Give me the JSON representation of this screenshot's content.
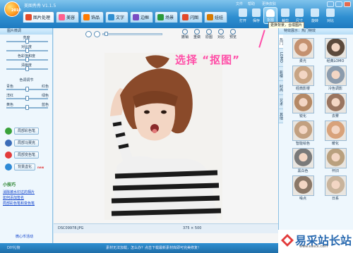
{
  "app": {
    "title": "美图秀秀 V1.1.5",
    "logo": "2010"
  },
  "tabs": [
    {
      "label": "图片处理",
      "color": "#e34a2a",
      "active": true
    },
    {
      "label": "美容",
      "color": "#ff5e8e"
    },
    {
      "label": "饰品",
      "color": "#ff7a00"
    },
    {
      "label": "文字",
      "color": "#2f8fd1"
    },
    {
      "label": "边框",
      "color": "#7a4bc2"
    },
    {
      "label": "场景",
      "color": "#2a9a3a"
    },
    {
      "label": "闪图",
      "color": "#e34a2a"
    },
    {
      "label": "娃娃",
      "color": "#d67a00"
    }
  ],
  "toolbar": [
    {
      "label": "打开",
      "icon": "folder-icon"
    },
    {
      "label": "保存",
      "icon": "save-icon"
    },
    {
      "label": "抠图",
      "icon": "cutout-icon"
    },
    {
      "label": "裁剪",
      "icon": "crop-icon"
    },
    {
      "label": "尺寸",
      "icon": "resize-icon"
    },
    {
      "label": "旋转",
      "icon": "rotate-icon"
    },
    {
      "label": "对比",
      "icon": "compare-icon"
    }
  ],
  "menu": [
    "文件",
    "帮助",
    "更换皮肤"
  ],
  "cutout_button": {
    "label": "抠图",
    "tooltip": "更换背景，合成图片"
  },
  "left": {
    "heading": "图片微调",
    "sliders": [
      {
        "label": "亮度",
        "value": 0.5
      },
      {
        "label": "对比度",
        "value": 0.5
      },
      {
        "label": "色彩饱和度",
        "value": 0.5
      },
      {
        "label": "清晰度",
        "value": 0.5
      }
    ],
    "color_heading": "色调调节",
    "color_sliders": [
      {
        "left": "青色",
        "right": "红色",
        "value": 0.5
      },
      {
        "left": "洋红",
        "right": "绿色",
        "value": 0.5
      },
      {
        "left": "黄色",
        "right": "蓝色",
        "value": 0.5
      }
    ],
    "effects": [
      {
        "label": "局部彩色笔",
        "color": "#3aa23a"
      },
      {
        "label": "局部马赛克",
        "color": "#3b6cb8"
      },
      {
        "label": "局部变色笔",
        "color": "#e23b3b"
      },
      {
        "label": "背景虚化",
        "color": "#2e8ad6",
        "badge": "new"
      }
    ],
    "tips_title": "小技巧",
    "tips": [
      "消除被水印过的相片",
      "如何添加签名",
      "局部彩色笔和变色笔"
    ],
    "promo": "微心币活动"
  },
  "center": {
    "edit_tools": [
      "撤销",
      "重做",
      "原图",
      "对比",
      "预览"
    ],
    "annotation": "选择 “抠图”",
    "status_file": "DSC09978.JPG",
    "status_size": "375 × 500"
  },
  "right": {
    "heading": "特效展示：热门特效",
    "vtabs": [
      "热门",
      "LOMO",
      "影楼",
      "时尚",
      "艺术",
      "其他"
    ],
    "effects": [
      {
        "label": "柔光",
        "color": "#c49170"
      },
      {
        "label": "经典LOMO",
        "color": "#5c4a3c"
      },
      {
        "label": "经典影楼",
        "color": "#c8a585"
      },
      {
        "label": "冷色调影",
        "color": "#8c9cad"
      },
      {
        "label": "锐化",
        "color": "#b58965"
      },
      {
        "label": "去雾",
        "color": "#9a7560"
      },
      {
        "label": "智能绘色",
        "color": "#c2a080"
      },
      {
        "label": "暖化",
        "color": "#d8a27a"
      },
      {
        "label": "黑白色",
        "color": "#7a7a7a"
      },
      {
        "label": "怀旧",
        "color": "#b9a07e"
      },
      {
        "label": "噪点",
        "color": "#8b7868"
      },
      {
        "label": "日系",
        "color": "#c9b49c"
      }
    ]
  },
  "bottom": {
    "left": "DIY礼物",
    "middle": "素材无法加载，怎么办？点击下载最新素材库即可完美修复！"
  },
  "watermark": {
    "text": "易采站长站",
    "url": "www.easck.com"
  }
}
